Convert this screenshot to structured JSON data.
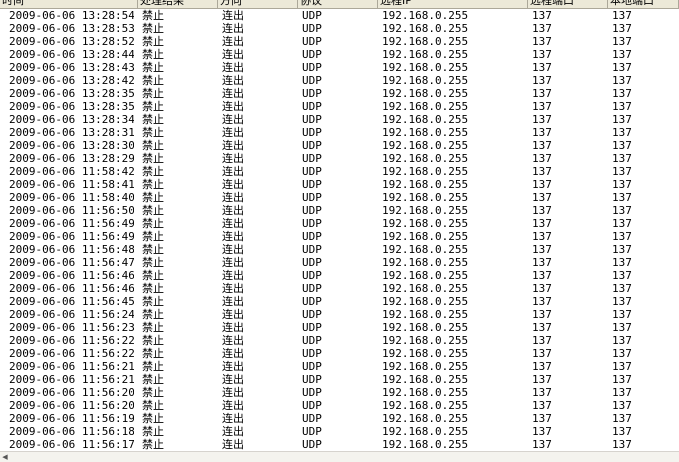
{
  "table": {
    "columns": [
      "时间",
      "处理结果",
      "方向",
      "协议",
      "远程IP",
      "远程端口",
      "本地端口"
    ],
    "rows": [
      [
        "2009-06-06 13:28:54",
        "禁止",
        "连出",
        "UDP",
        "192.168.0.255",
        "137",
        "137"
      ],
      [
        "2009-06-06 13:28:53",
        "禁止",
        "连出",
        "UDP",
        "192.168.0.255",
        "137",
        "137"
      ],
      [
        "2009-06-06 13:28:52",
        "禁止",
        "连出",
        "UDP",
        "192.168.0.255",
        "137",
        "137"
      ],
      [
        "2009-06-06 13:28:44",
        "禁止",
        "连出",
        "UDP",
        "192.168.0.255",
        "137",
        "137"
      ],
      [
        "2009-06-06 13:28:43",
        "禁止",
        "连出",
        "UDP",
        "192.168.0.255",
        "137",
        "137"
      ],
      [
        "2009-06-06 13:28:42",
        "禁止",
        "连出",
        "UDP",
        "192.168.0.255",
        "137",
        "137"
      ],
      [
        "2009-06-06 13:28:35",
        "禁止",
        "连出",
        "UDP",
        "192.168.0.255",
        "137",
        "137"
      ],
      [
        "2009-06-06 13:28:35",
        "禁止",
        "连出",
        "UDP",
        "192.168.0.255",
        "137",
        "137"
      ],
      [
        "2009-06-06 13:28:34",
        "禁止",
        "连出",
        "UDP",
        "192.168.0.255",
        "137",
        "137"
      ],
      [
        "2009-06-06 13:28:31",
        "禁止",
        "连出",
        "UDP",
        "192.168.0.255",
        "137",
        "137"
      ],
      [
        "2009-06-06 13:28:30",
        "禁止",
        "连出",
        "UDP",
        "192.168.0.255",
        "137",
        "137"
      ],
      [
        "2009-06-06 13:28:29",
        "禁止",
        "连出",
        "UDP",
        "192.168.0.255",
        "137",
        "137"
      ],
      [
        "2009-06-06 11:58:42",
        "禁止",
        "连出",
        "UDP",
        "192.168.0.255",
        "137",
        "137"
      ],
      [
        "2009-06-06 11:58:41",
        "禁止",
        "连出",
        "UDP",
        "192.168.0.255",
        "137",
        "137"
      ],
      [
        "2009-06-06 11:58:40",
        "禁止",
        "连出",
        "UDP",
        "192.168.0.255",
        "137",
        "137"
      ],
      [
        "2009-06-06 11:56:50",
        "禁止",
        "连出",
        "UDP",
        "192.168.0.255",
        "137",
        "137"
      ],
      [
        "2009-06-06 11:56:49",
        "禁止",
        "连出",
        "UDP",
        "192.168.0.255",
        "137",
        "137"
      ],
      [
        "2009-06-06 11:56:49",
        "禁止",
        "连出",
        "UDP",
        "192.168.0.255",
        "137",
        "137"
      ],
      [
        "2009-06-06 11:56:48",
        "禁止",
        "连出",
        "UDP",
        "192.168.0.255",
        "137",
        "137"
      ],
      [
        "2009-06-06 11:56:47",
        "禁止",
        "连出",
        "UDP",
        "192.168.0.255",
        "137",
        "137"
      ],
      [
        "2009-06-06 11:56:46",
        "禁止",
        "连出",
        "UDP",
        "192.168.0.255",
        "137",
        "137"
      ],
      [
        "2009-06-06 11:56:46",
        "禁止",
        "连出",
        "UDP",
        "192.168.0.255",
        "137",
        "137"
      ],
      [
        "2009-06-06 11:56:45",
        "禁止",
        "连出",
        "UDP",
        "192.168.0.255",
        "137",
        "137"
      ],
      [
        "2009-06-06 11:56:24",
        "禁止",
        "连出",
        "UDP",
        "192.168.0.255",
        "137",
        "137"
      ],
      [
        "2009-06-06 11:56:23",
        "禁止",
        "连出",
        "UDP",
        "192.168.0.255",
        "137",
        "137"
      ],
      [
        "2009-06-06 11:56:22",
        "禁止",
        "连出",
        "UDP",
        "192.168.0.255",
        "137",
        "137"
      ],
      [
        "2009-06-06 11:56:22",
        "禁止",
        "连出",
        "UDP",
        "192.168.0.255",
        "137",
        "137"
      ],
      [
        "2009-06-06 11:56:21",
        "禁止",
        "连出",
        "UDP",
        "192.168.0.255",
        "137",
        "137"
      ],
      [
        "2009-06-06 11:56:21",
        "禁止",
        "连出",
        "UDP",
        "192.168.0.255",
        "137",
        "137"
      ],
      [
        "2009-06-06 11:56:20",
        "禁止",
        "连出",
        "UDP",
        "192.168.0.255",
        "137",
        "137"
      ],
      [
        "2009-06-06 11:56:20",
        "禁止",
        "连出",
        "UDP",
        "192.168.0.255",
        "137",
        "137"
      ],
      [
        "2009-06-06 11:56:19",
        "禁止",
        "连出",
        "UDP",
        "192.168.0.255",
        "137",
        "137"
      ],
      [
        "2009-06-06 11:56:18",
        "禁止",
        "连出",
        "UDP",
        "192.168.0.255",
        "137",
        "137"
      ],
      [
        "2009-06-06 11:56:17",
        "禁止",
        "连出",
        "UDP",
        "192.168.0.255",
        "137",
        "137"
      ]
    ]
  },
  "scrollbar": {
    "left_arrow_icon": "chevron-left-icon",
    "left_arrow_glyph": "◀"
  },
  "colors": {
    "header_background": "#ece9d8",
    "header_border": "#aca899",
    "row_background": "#ffffff",
    "text": "#000000"
  }
}
